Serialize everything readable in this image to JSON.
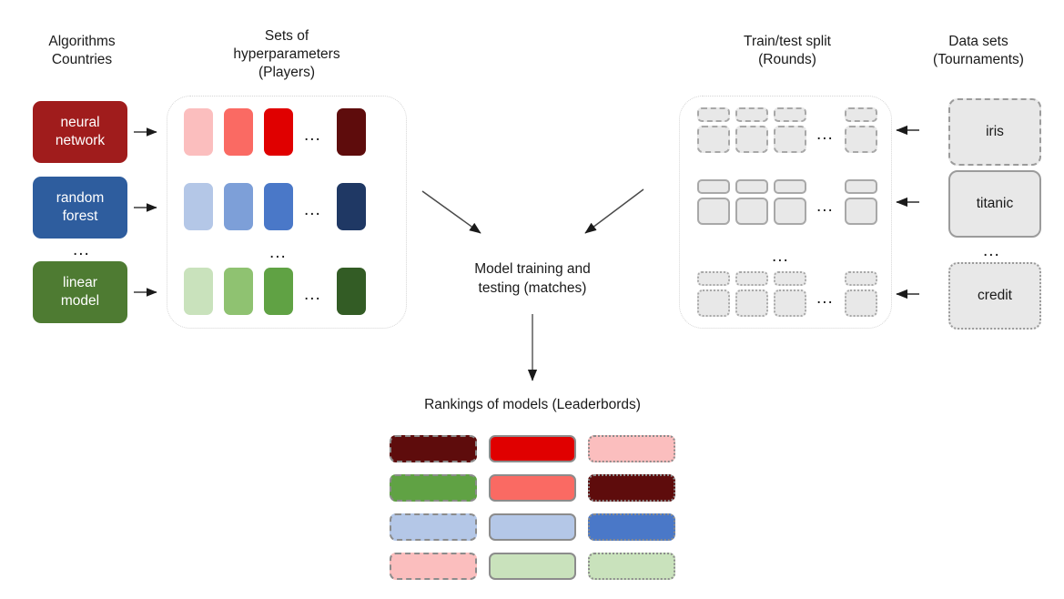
{
  "headings": {
    "algorithms": "Algorithms\nCountries",
    "hyperparameters": "Sets of\nhyperparameters\n(Players)",
    "rounds": "Train/test split\n(Rounds)",
    "datasets": "Data sets\n(Tournaments)"
  },
  "center": {
    "caption": "Model training and\ntesting (matches)"
  },
  "leaderboard": {
    "caption": "Rankings of models (Leaderbords)"
  },
  "ellipsis": "...",
  "algorithms": [
    {
      "label": "neural\nnetwork",
      "color": "#A01C1C"
    },
    {
      "label": "random\nforest",
      "color": "#2E5D9E"
    },
    {
      "label": "linear\nmodel",
      "color": "#4E7B32"
    }
  ],
  "datasets": [
    {
      "label": "iris",
      "border": "dashed"
    },
    {
      "label": "titanic",
      "border": "solid"
    },
    {
      "label": "credit",
      "border": "dotted"
    }
  ],
  "hyperparameter_rows": [
    {
      "family": "red",
      "colors": [
        "#FBBEBE",
        "#FA6A63",
        "#E00000",
        "#5E0C0C"
      ]
    },
    {
      "family": "blue",
      "colors": [
        "#B4C7E7",
        "#7D9FD8",
        "#4A78C8",
        "#1F3864"
      ]
    },
    {
      "family": "green",
      "colors": [
        "#C9E2BC",
        "#8FC271",
        "#60A244",
        "#335C25"
      ]
    }
  ],
  "round_rows": [
    {
      "dataset": "iris",
      "border": "dashed"
    },
    {
      "dataset": "titanic",
      "border": "solid"
    },
    {
      "dataset": "credit",
      "border": "dotted"
    }
  ],
  "leaderboard_grid": {
    "columns": [
      {
        "border": "dashed",
        "cells": [
          "#5E0C0C",
          "#60A244",
          "#B4C7E7",
          "#FBBEBE"
        ]
      },
      {
        "border": "solid",
        "cells": [
          "#E00000",
          "#FA6A63",
          "#B4C7E7",
          "#C9E2BC"
        ]
      },
      {
        "border": "dotted",
        "cells": [
          "#FBBEBE",
          "#5E0C0C",
          "#4A78C8",
          "#C9E2BC"
        ]
      }
    ]
  },
  "colors": {
    "background": "#FFFFFF",
    "text": "#1A1A1A",
    "container_border": "#D5D5D5",
    "pill_border": "#9B9B9B",
    "pill_fill": "#E8E8E8",
    "arrow": "#404040"
  }
}
